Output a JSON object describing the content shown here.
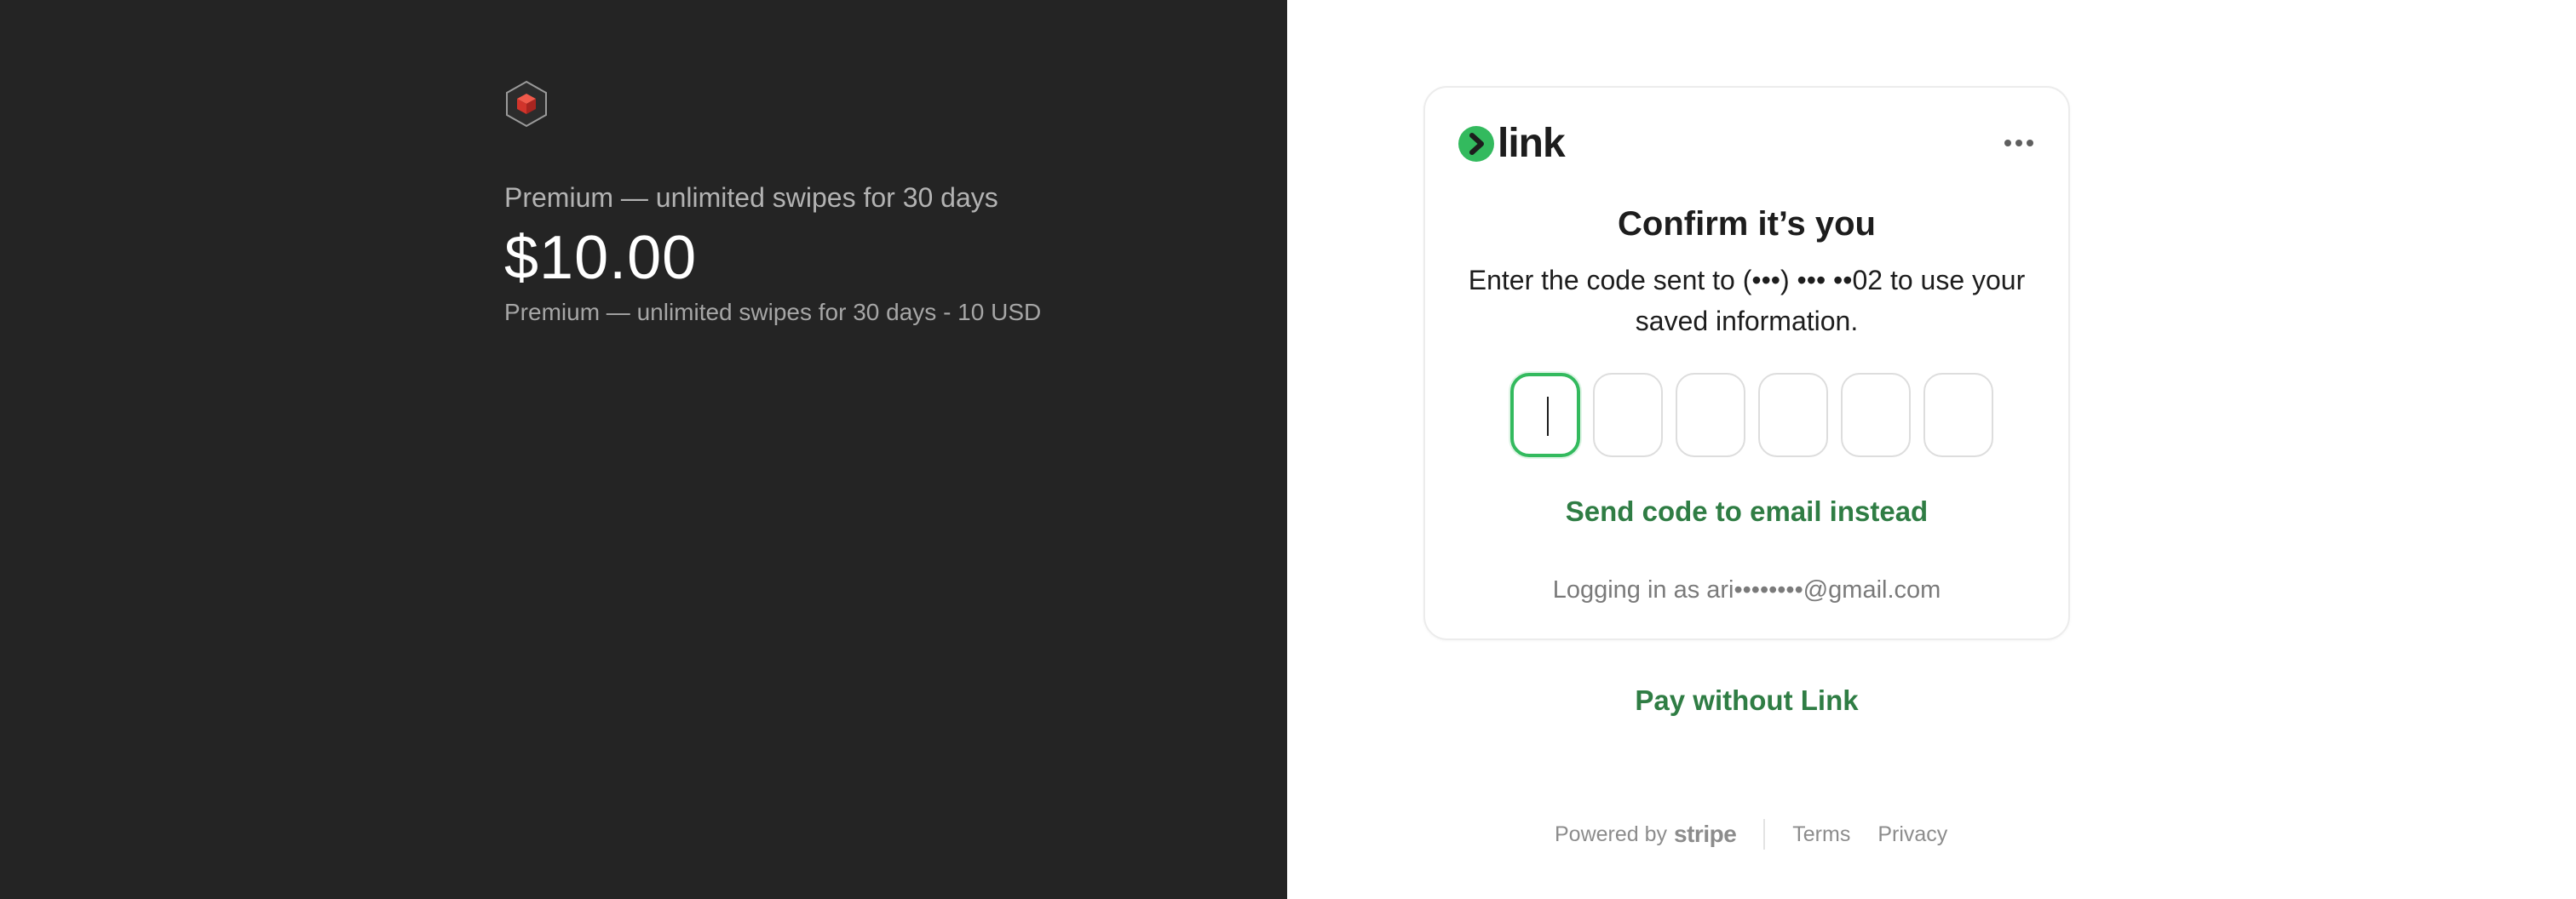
{
  "merchant": {
    "logo_icon": "hexagon-cube-icon",
    "product_name": "Premium — unlimited swipes for 30 days",
    "price": "$10.00",
    "line_item": "Premium — unlimited swipes for 30 days - 10 USD"
  },
  "link_card": {
    "logo_icon": "link-arrow-icon",
    "logo_text": "link",
    "menu_icon": "more-horizontal-icon",
    "title": "Confirm it’s you",
    "description": "Enter the code sent to (•••) ••• ••02 to use your saved information.",
    "otp_boxes": [
      "",
      "",
      "",
      "",
      "",
      ""
    ],
    "send_email_link": "Send code to email instead",
    "logging_in": "Logging in as ari••••••••@gmail.com"
  },
  "pay_without_link": "Pay without Link",
  "footer": {
    "powered_by": "Powered by",
    "powered_brand": "stripe",
    "terms": "Terms",
    "privacy": "Privacy"
  },
  "colors": {
    "left_background": "#242424",
    "link_green": "#33ba5e",
    "action_green": "#2f7d44",
    "logo_red": "#e0322b"
  }
}
